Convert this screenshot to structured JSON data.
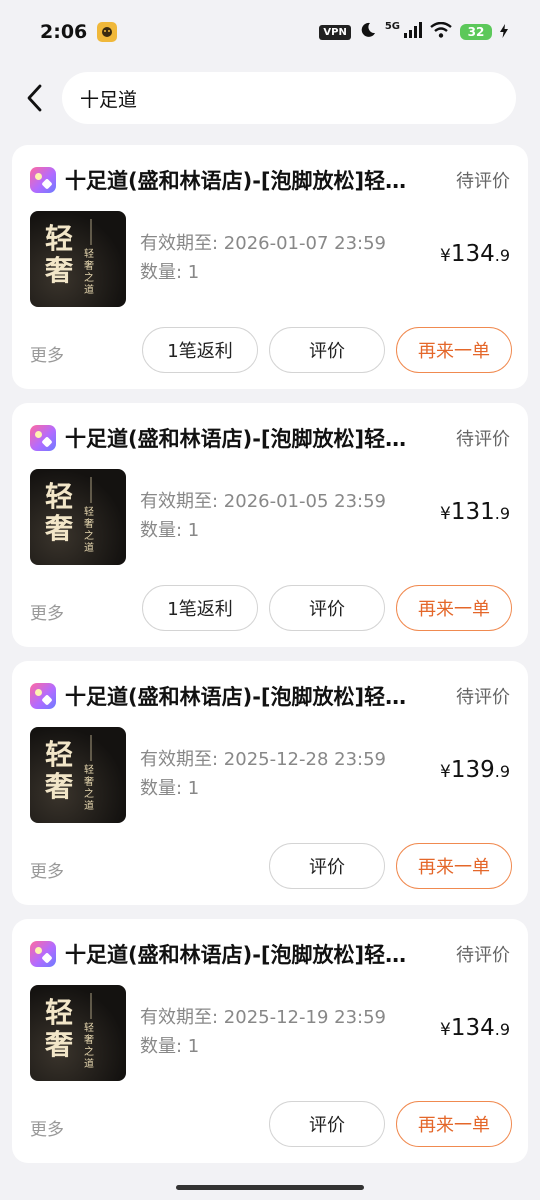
{
  "status_bar": {
    "time": "2:06",
    "vpn": "VPN",
    "network": "5G",
    "battery": "32"
  },
  "search": {
    "query": "十足道"
  },
  "orders": [
    {
      "shop": "十足道(盛和林语店)-[泡脚放松]轻…",
      "status": "待评价",
      "thumb_big": "轻奢",
      "thumb_small": "轻奢之道",
      "validity": "有效期至: 2026-01-07 23:59",
      "quantity": "数量: 1",
      "price_symbol": "¥",
      "price_int": "134",
      "price_dec": ".9",
      "more": "更多",
      "rebate": "1笔返利",
      "review": "评价",
      "reorder": "再来一单"
    },
    {
      "shop": "十足道(盛和林语店)-[泡脚放松]轻…",
      "status": "待评价",
      "thumb_big": "轻奢",
      "thumb_small": "轻奢之道",
      "validity": "有效期至: 2026-01-05 23:59",
      "quantity": "数量: 1",
      "price_symbol": "¥",
      "price_int": "131",
      "price_dec": ".9",
      "more": "更多",
      "rebate": "1笔返利",
      "review": "评价",
      "reorder": "再来一单"
    },
    {
      "shop": "十足道(盛和林语店)-[泡脚放松]轻…",
      "status": "待评价",
      "thumb_big": "轻奢",
      "thumb_small": "轻奢之道",
      "validity": "有效期至: 2025-12-28 23:59",
      "quantity": "数量: 1",
      "price_symbol": "¥",
      "price_int": "139",
      "price_dec": ".9",
      "more": "更多",
      "review": "评价",
      "reorder": "再来一单"
    },
    {
      "shop": "十足道(盛和林语店)-[泡脚放松]轻…",
      "status": "待评价",
      "thumb_big": "轻奢",
      "thumb_small": "轻奢之道",
      "validity": "有效期至: 2025-12-19 23:59",
      "quantity": "数量: 1",
      "price_symbol": "¥",
      "price_int": "134",
      "price_dec": ".9",
      "more": "更多",
      "review": "评价",
      "reorder": "再来一单"
    }
  ]
}
